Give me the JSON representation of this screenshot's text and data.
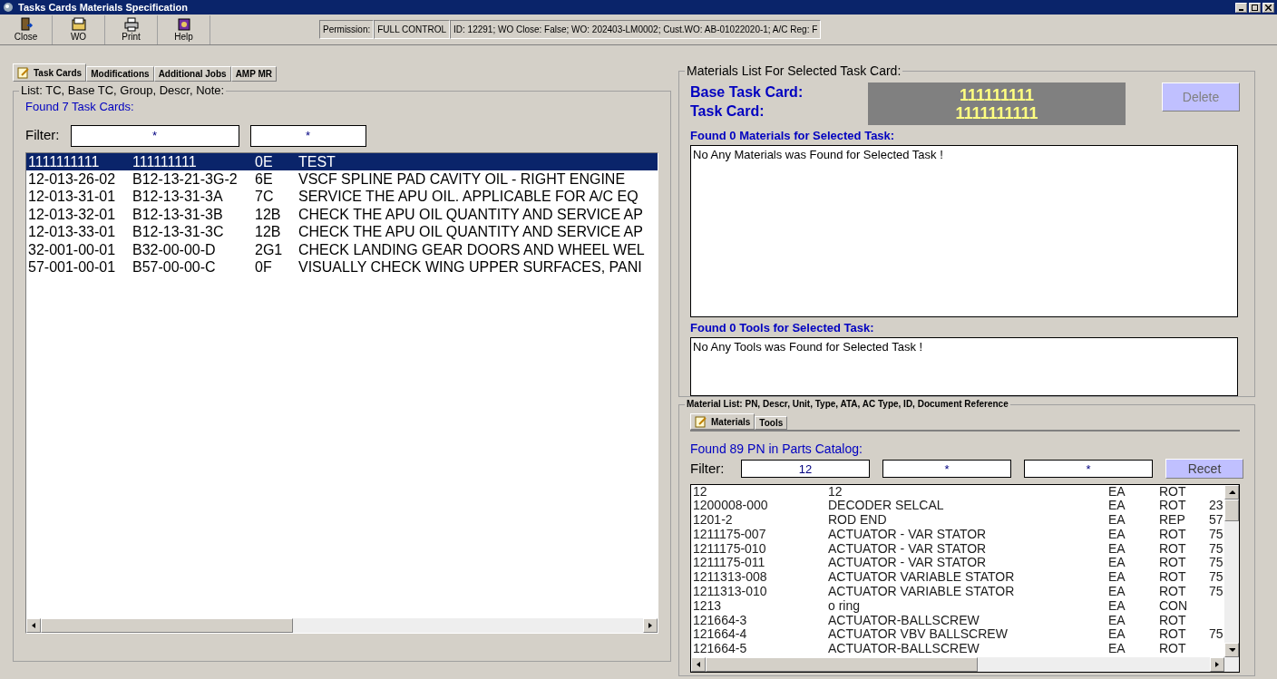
{
  "window": {
    "title": "Tasks Cards Materials Specification"
  },
  "toolbar": [
    {
      "label": "Close",
      "kind": "close"
    },
    {
      "label": "WO",
      "kind": "wo"
    },
    {
      "label": "Print",
      "kind": "print"
    },
    {
      "label": "Help",
      "kind": "help"
    }
  ],
  "status": {
    "permission_label": "Permission:",
    "permission": "FULL CONTROL",
    "info": "ID: 12291; WO Close: False; WO: 202403-LM0002; Cust.WO: AB-01022020-1; A/C Reg: F"
  },
  "tabs": [
    {
      "label": "Task Cards",
      "selected": true
    },
    {
      "label": "Modifications",
      "selected": false
    },
    {
      "label": "Additional Jobs",
      "selected": false
    },
    {
      "label": "AMP MR",
      "selected": false
    }
  ],
  "task_list": {
    "group_title": "List: TC, Base TC, Group, Descr, Note:",
    "found": "Found 7 Task Cards:",
    "filter_label": "Filter:",
    "filters": [
      {
        "value": "*"
      },
      {
        "value": "*"
      }
    ],
    "rows": [
      {
        "cells": [
          "1111111111",
          "111111111",
          "0E",
          "TEST"
        ],
        "selected": true
      },
      {
        "cells": [
          "12-013-26-02",
          "B12-13-21-3G-2",
          "6E",
          "VSCF SPLINE PAD CAVITY OIL - RIGHT ENGINE"
        ],
        "selected": false
      },
      {
        "cells": [
          "12-013-31-01",
          "B12-13-31-3A",
          "7C",
          "SERVICE THE APU OIL. APPLICABLE FOR A/C EQ"
        ],
        "selected": false
      },
      {
        "cells": [
          "12-013-32-01",
          "B12-13-31-3B",
          "12B",
          "CHECK THE APU OIL QUANTITY AND SERVICE AP"
        ],
        "selected": false
      },
      {
        "cells": [
          "12-013-33-01",
          "B12-13-31-3C",
          "12B",
          "CHECK THE APU OIL QUANTITY AND SERVICE AP"
        ],
        "selected": false
      },
      {
        "cells": [
          "32-001-00-01",
          "B32-00-00-D",
          "2G1",
          "CHECK LANDING GEAR DOORS AND WHEEL WEL"
        ],
        "selected": false
      },
      {
        "cells": [
          "57-001-00-01",
          "B57-00-00-C",
          "0F",
          "VISUALLY CHECK WING UPPER SURFACES, PANI"
        ],
        "selected": false
      }
    ]
  },
  "materials": {
    "group_title": "Materials List For Selected Task Card:",
    "base_label": "Base Task Card:",
    "task_label": "Task Card:",
    "base_value": "111111111",
    "task_value": "1111111111",
    "delete_button": "Delete",
    "materials_found": "Found 0 Materials for Selected Task:",
    "materials_message": "No Any Materials was Found for Selected Task !",
    "tools_found": "Found 0 Tools for Selected Task:",
    "tools_message": "No Any Tools was Found for Selected Task !"
  },
  "catalog": {
    "group_title": "Material List: PN, Descr, Unit, Type, ATA, AC Type, ID, Document Reference",
    "tabs": [
      {
        "label": "Materials",
        "selected": true
      },
      {
        "label": "Tools",
        "selected": false
      }
    ],
    "found": "Found 89 PN in Parts Catalog:",
    "filter_label": "Filter:",
    "filters": [
      {
        "value": "12"
      },
      {
        "placeholder": "*"
      },
      {
        "placeholder": "*"
      }
    ],
    "reset_button": "Recet",
    "rows": [
      [
        "12",
        "12",
        "EA",
        "ROT",
        ""
      ],
      [
        "1200008-000",
        "DECODER SELCAL",
        "EA",
        "ROT",
        "23"
      ],
      [
        "1201-2",
        "ROD END",
        "EA",
        "REP",
        "57"
      ],
      [
        "1211175-007",
        "ACTUATOR - VAR STATOR",
        "EA",
        "ROT",
        "75"
      ],
      [
        "1211175-010",
        "ACTUATOR - VAR STATOR",
        "EA",
        "ROT",
        "75"
      ],
      [
        "1211175-011",
        "ACTUATOR - VAR STATOR",
        "EA",
        "ROT",
        "75"
      ],
      [
        "1211313-008",
        "ACTUATOR VARIABLE STATOR",
        "EA",
        "ROT",
        "75"
      ],
      [
        "1211313-010",
        "ACTUATOR VARIABLE STATOR",
        "EA",
        "ROT",
        "75"
      ],
      [
        "1213",
        "o ring",
        "EA",
        "CON",
        ""
      ],
      [
        "121664-3",
        "ACTUATOR-BALLSCREW",
        "EA",
        "ROT",
        ""
      ],
      [
        "121664-4",
        "ACTUATOR VBV BALLSCREW",
        "EA",
        "ROT",
        "75"
      ],
      [
        "121664-5",
        "ACTUATOR-BALLSCREW",
        "EA",
        "ROT",
        ""
      ]
    ]
  }
}
